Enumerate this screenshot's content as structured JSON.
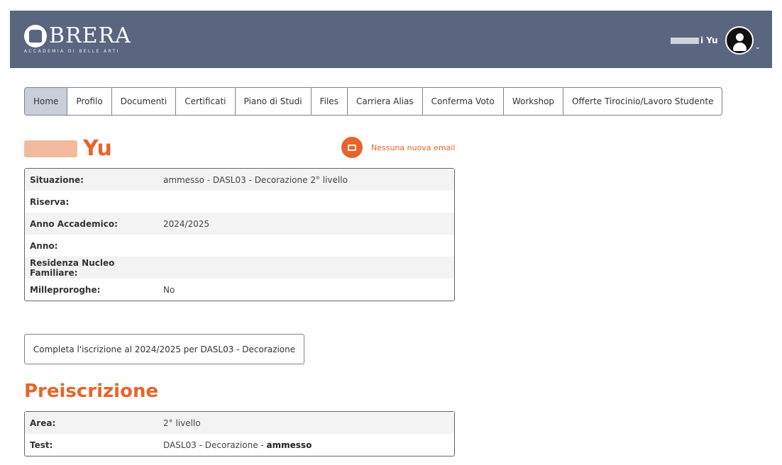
{
  "header": {
    "logo_name": "BRERA",
    "logo_sub": "ACCADEMIA DI BELLE ARTI",
    "user_name": "i Yu",
    "colors": {
      "header_bg": "#5a6580",
      "accent": "#e8642a"
    }
  },
  "tabs": [
    {
      "label": "Home",
      "active": true
    },
    {
      "label": "Profilo"
    },
    {
      "label": "Documenti"
    },
    {
      "label": "Certificati"
    },
    {
      "label": "Piano di Studi"
    },
    {
      "label": "Files"
    },
    {
      "label": "Carriera Alias"
    },
    {
      "label": "Conferma Voto"
    },
    {
      "label": "Workshop"
    },
    {
      "label": "Offerte Tirocinio/Lavoro Studente"
    }
  ],
  "student": {
    "name": "Yu"
  },
  "email": {
    "label": "Nessuna nuova email",
    "icon": "mail-icon"
  },
  "info": {
    "rows": [
      {
        "label": "Situazione:",
        "value": "ammesso - DASL03 - Decorazione 2° livello"
      },
      {
        "label": "Riserva:",
        "value": ""
      },
      {
        "label": "Anno Accademico:",
        "value": "2024/2025"
      },
      {
        "label": "Anno:",
        "value": ""
      },
      {
        "label": "Residenza Nucleo Familiare:",
        "value": ""
      },
      {
        "label": "Milleproroghe:",
        "value": "No"
      }
    ]
  },
  "enroll_button": "Completa l'iscrizione al 2024/2025 per DASL03 - Decorazione",
  "preiscrizione": {
    "title": "Preiscrizione",
    "area_label": "Area:",
    "area_value": "2° livello",
    "test_label": "Test:",
    "test_value": "DASL03 - Decorazione - ",
    "test_status": "ammesso"
  }
}
